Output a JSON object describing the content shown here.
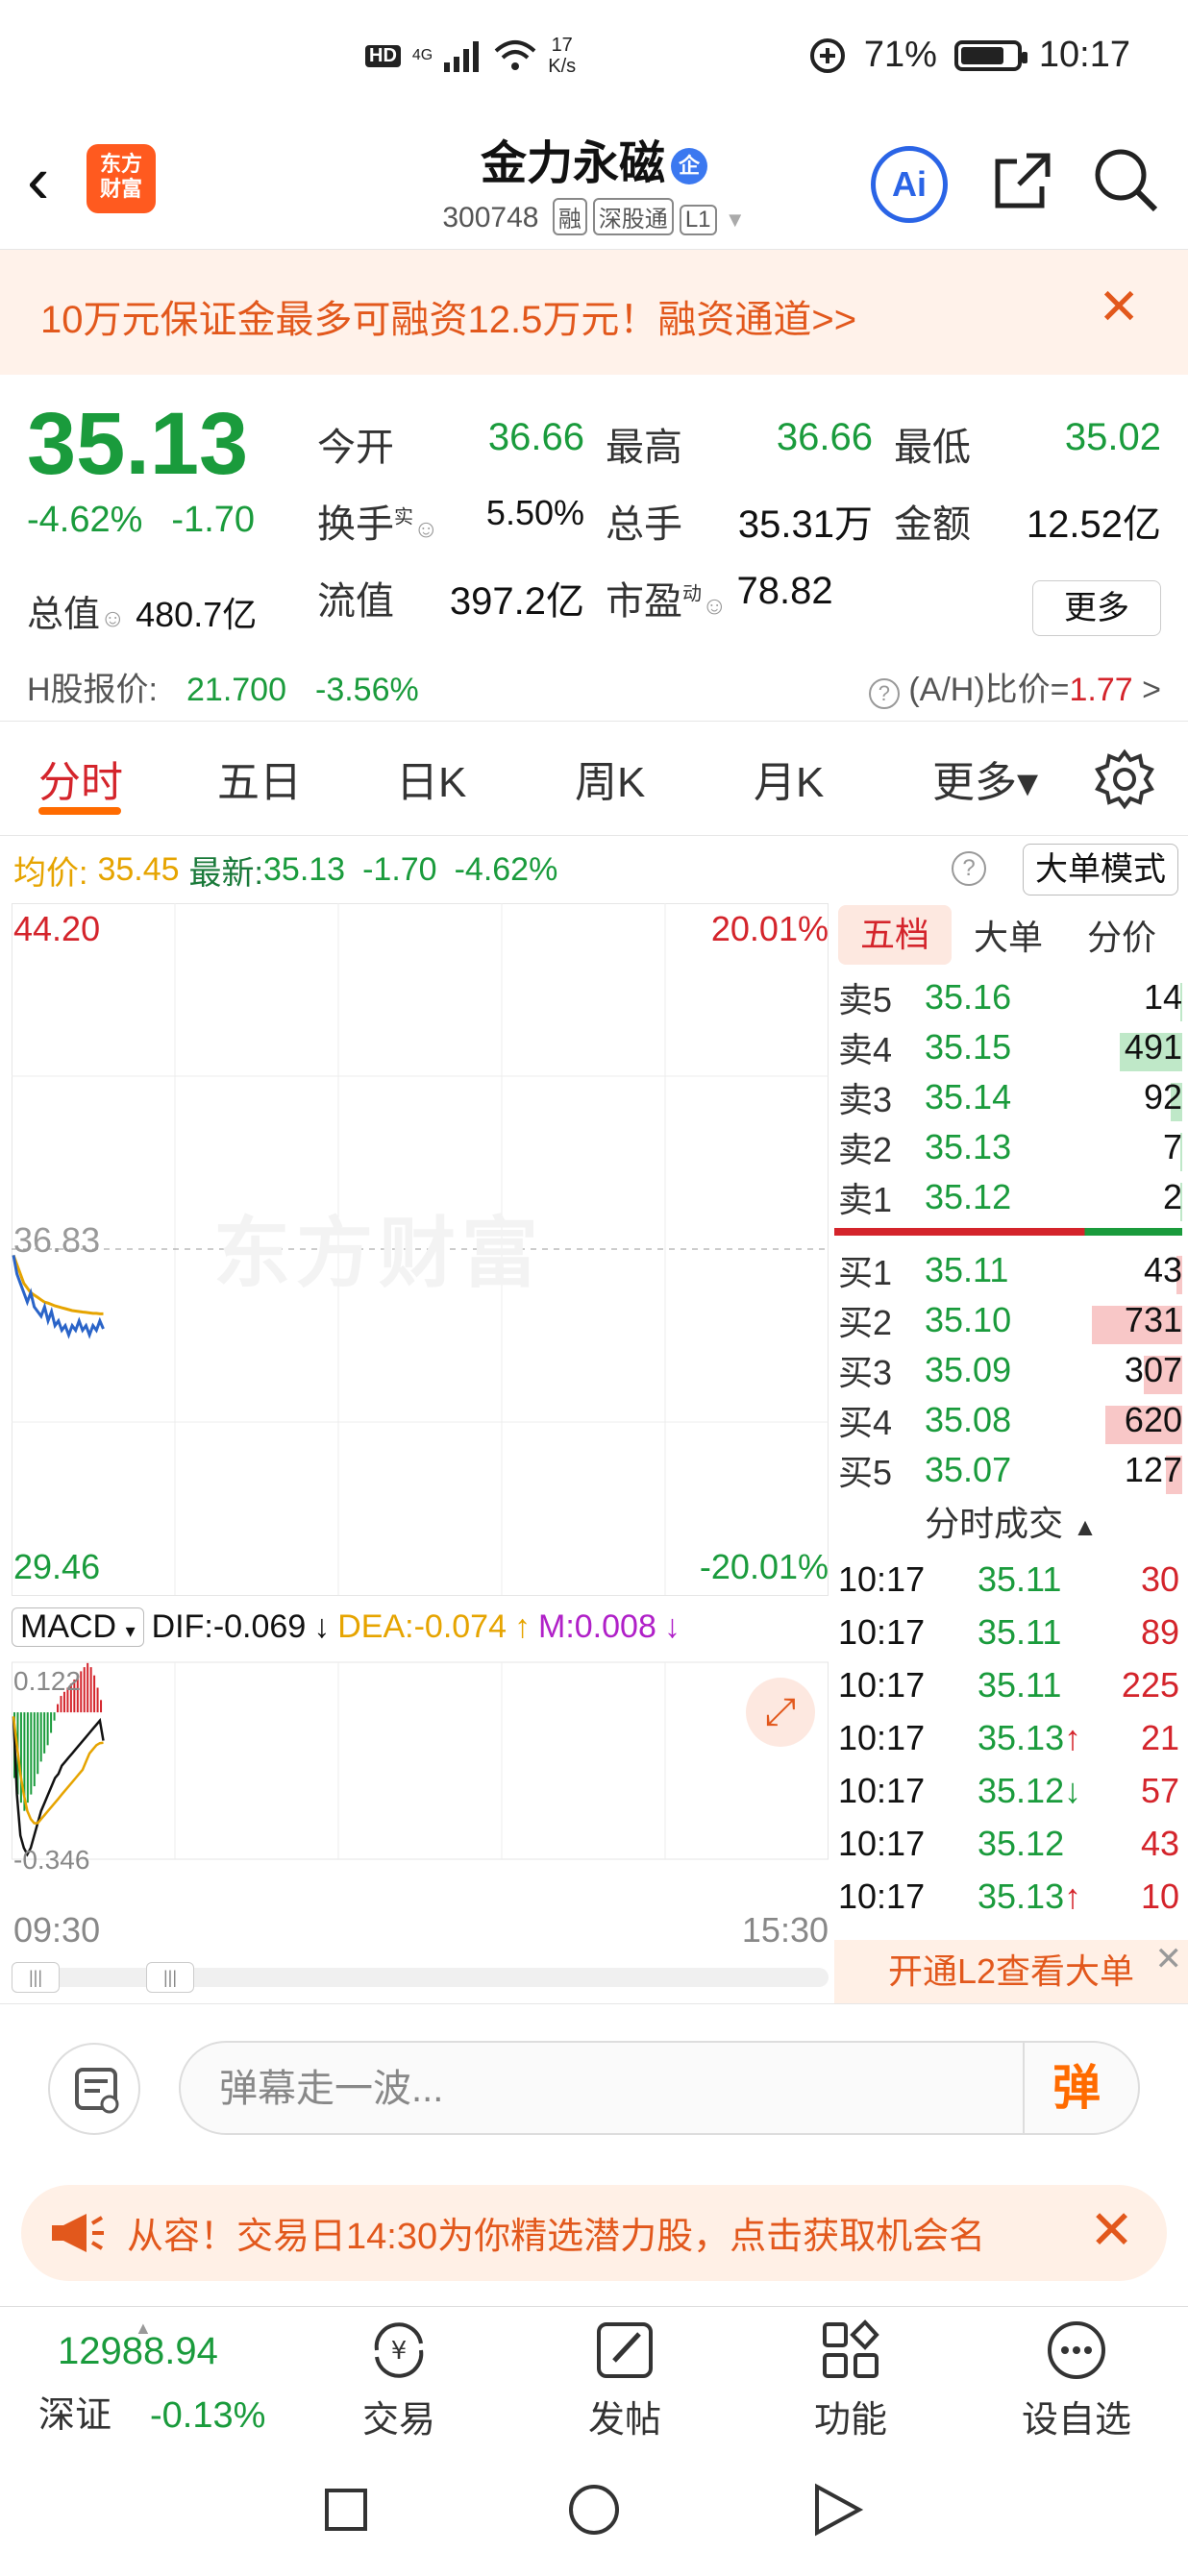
{
  "status_bar": {
    "hd": "HD",
    "network": "4G",
    "speed_value": "17",
    "speed_unit": "K/s",
    "battery": "71%",
    "time": "10:17"
  },
  "header": {
    "back_label": "‹",
    "logo_line1": "东方",
    "logo_line2": "财富",
    "stock_name": "金力永磁",
    "badge": "企",
    "code": "300748",
    "tags": [
      "融",
      "深股通",
      "L1"
    ],
    "ai_label": "Ai"
  },
  "banner": {
    "text": "10万元保证金最多可融资12.5万元！融资通道>>",
    "close": "✕"
  },
  "quote": {
    "price": "35.13",
    "change_pct": "-4.62%",
    "change": "-1.70",
    "stats": [
      [
        {
          "label": "今开",
          "value": "36.66",
          "color": "g"
        },
        {
          "label": "最高",
          "value": "36.66",
          "color": "g"
        },
        {
          "label": "最低",
          "value": "35.02",
          "color": "g"
        }
      ],
      [
        {
          "label": "换手",
          "sup": "实",
          "value": "5.50%",
          "color": "k"
        },
        {
          "label": "总手",
          "value": "35.31万",
          "color": "k"
        },
        {
          "label": "金额",
          "value": "12.52亿",
          "color": "k"
        }
      ],
      [
        {
          "label": "流值",
          "value": "397.2亿",
          "color": "k"
        },
        {
          "label": "市盈",
          "sup": "动",
          "value": "78.82",
          "color": "k"
        }
      ]
    ],
    "total_label": "总值",
    "total_value": "480.7亿",
    "more": "更多",
    "h_label": "H股报价:",
    "h_price": "21.700",
    "h_change": "-3.56%",
    "ah_label": "(A/H)比价=",
    "ah_value": "1.77",
    "ah_arrow": ">"
  },
  "tabs": [
    "分时",
    "五日",
    "日K",
    "周K",
    "月K",
    "更多▾"
  ],
  "info_line": {
    "avg_label": "均价:",
    "avg_value": "35.45",
    "latest_label": "最新:",
    "latest_value": "35.13",
    "change": "-1.70",
    "change_pct": "-4.62%",
    "big_order_mode": "大单模式"
  },
  "chart_data": {
    "type": "line",
    "y_max_label": "44.20",
    "y_mid_label": "36.83",
    "y_min_label": "29.46",
    "pct_max_label": "20.01%",
    "pct_min_label": "-20.01%",
    "ylim": [
      29.46,
      44.2
    ],
    "reference": 36.83,
    "x_start": "09:30",
    "x_end": "15:30",
    "series": [
      {
        "name": "最新",
        "values": [
          36.7,
          36.3,
          36.1,
          35.9,
          35.7,
          35.9,
          35.6,
          35.5,
          35.4,
          35.6,
          35.3,
          35.5,
          35.2,
          35.3,
          35.1,
          35.2,
          35.0,
          35.2,
          35.1,
          35.3,
          35.1,
          35.2,
          35.0,
          35.2,
          35.1,
          35.3,
          35.13
        ]
      },
      {
        "name": "均价",
        "values": [
          36.7,
          36.5,
          36.3,
          36.1,
          36.0,
          35.9,
          35.85,
          35.8,
          35.75,
          35.7,
          35.68,
          35.65,
          35.62,
          35.6,
          35.58,
          35.56,
          35.54,
          35.52,
          35.51,
          35.5,
          35.49,
          35.48,
          35.47,
          35.46,
          35.46,
          35.45,
          35.45
        ]
      }
    ],
    "watermark": "东方财富"
  },
  "macd": {
    "label": "MACD",
    "dif_label": "DIF:-0.069",
    "dea_label": "DEA:-0.074",
    "m_label": "M:0.008",
    "top_label": "0.122",
    "bottom_label": "-0.346",
    "ylim": [
      -0.346,
      0.122
    ],
    "bars": [
      -0.16,
      -0.2,
      -0.22,
      -0.24,
      -0.22,
      -0.2,
      -0.18,
      -0.15,
      -0.12,
      -0.1,
      -0.08,
      -0.05,
      -0.02,
      0.02,
      0.04,
      0.05,
      0.06,
      0.07,
      0.08,
      0.09,
      0.1,
      0.11,
      0.12,
      0.11,
      0.09,
      0.06,
      0.03
    ],
    "dif": [
      -0.01,
      -0.2,
      -0.3,
      -0.33,
      -0.346,
      -0.33,
      -0.3,
      -0.27,
      -0.24,
      -0.22,
      -0.2,
      -0.18,
      -0.16,
      -0.15,
      -0.13,
      -0.12,
      -0.11,
      -0.1,
      -0.09,
      -0.08,
      -0.07,
      -0.06,
      -0.05,
      -0.04,
      -0.03,
      -0.02,
      -0.069
    ],
    "dea": [
      -0.01,
      -0.08,
      -0.15,
      -0.2,
      -0.24,
      -0.26,
      -0.27,
      -0.27,
      -0.26,
      -0.25,
      -0.24,
      -0.23,
      -0.22,
      -0.21,
      -0.2,
      -0.19,
      -0.18,
      -0.17,
      -0.16,
      -0.15,
      -0.14,
      -0.12,
      -0.1,
      -0.09,
      -0.08,
      -0.075,
      -0.074
    ]
  },
  "order_book": {
    "tabs": [
      "五档",
      "大单",
      "分价"
    ],
    "asks": [
      {
        "label": "卖5",
        "price": "35.16",
        "vol": "14",
        "bar": 0.02
      },
      {
        "label": "卖4",
        "price": "35.15",
        "vol": "491",
        "bar": 0.55
      },
      {
        "label": "卖3",
        "price": "35.14",
        "vol": "92",
        "bar": 0.1
      },
      {
        "label": "卖2",
        "price": "35.13",
        "vol": "7",
        "bar": 0.01
      },
      {
        "label": "卖1",
        "price": "35.12",
        "vol": "2",
        "bar": 0.01
      }
    ],
    "bids": [
      {
        "label": "买1",
        "price": "35.11",
        "vol": "43",
        "bar": 0.05
      },
      {
        "label": "买2",
        "price": "35.10",
        "vol": "731",
        "bar": 0.8
      },
      {
        "label": "买3",
        "price": "35.09",
        "vol": "307",
        "bar": 0.34
      },
      {
        "label": "买4",
        "price": "35.08",
        "vol": "620",
        "bar": 0.68
      },
      {
        "label": "买5",
        "price": "35.07",
        "vol": "127",
        "bar": 0.14
      }
    ],
    "ticks_title": "分时成交",
    "ticks": [
      {
        "t": "10:17",
        "p": "35.11",
        "v": "30",
        "arrow": ""
      },
      {
        "t": "10:17",
        "p": "35.11",
        "v": "89",
        "arrow": ""
      },
      {
        "t": "10:17",
        "p": "35.11",
        "v": "225",
        "arrow": ""
      },
      {
        "t": "10:17",
        "p": "35.13",
        "v": "21",
        "arrow": "↑"
      },
      {
        "t": "10:17",
        "p": "35.12",
        "v": "57",
        "arrow": "↓"
      },
      {
        "t": "10:17",
        "p": "35.12",
        "v": "43",
        "arrow": ""
      },
      {
        "t": "10:17",
        "p": "35.13",
        "v": "10",
        "arrow": "↑"
      }
    ],
    "l2_text": "开通L2查看大单",
    "l2_close": "✕"
  },
  "comment": {
    "placeholder": "弹幕走一波...",
    "button": "弹"
  },
  "promo": {
    "text": "从容！交易日14:30为你精选潜力股，点击获取机会名",
    "close": "✕"
  },
  "bottom_nav": {
    "index_value": "12988.94",
    "index_name": "深证",
    "index_change": "-0.13%",
    "items": [
      "交易",
      "发帖",
      "功能",
      "设自选"
    ]
  }
}
